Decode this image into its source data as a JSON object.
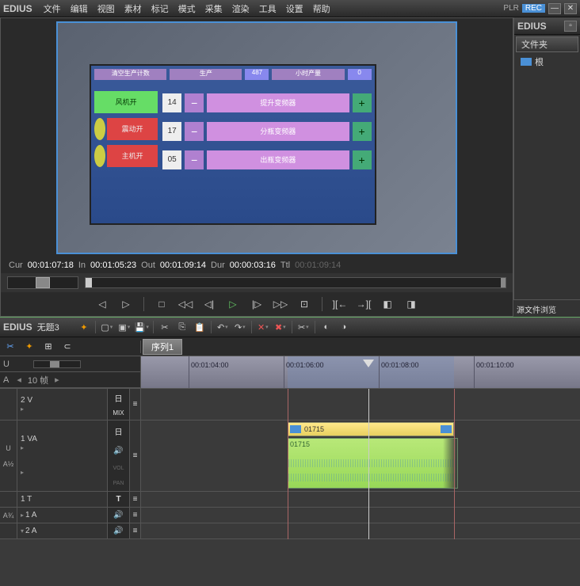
{
  "app": {
    "name": "EDIUS"
  },
  "menus": [
    "文件",
    "编辑",
    "视图",
    "素材",
    "标记",
    "模式",
    "采集",
    "渲染",
    "工具",
    "设置",
    "帮助"
  ],
  "recorder": {
    "plr": "PLR",
    "rec": "REC"
  },
  "sidePanel": {
    "tab": "文件夹",
    "item": "根",
    "bottom": "源文件浏览"
  },
  "monitor": {
    "topBoxes": [
      "清空生产计数",
      "生产",
      "487",
      "小时产量",
      "0"
    ],
    "leftButtons": [
      {
        "label": "风机开",
        "style": "green"
      },
      {
        "label": "震动开",
        "style": "red"
      },
      {
        "label": "主机开",
        "style": "red"
      }
    ],
    "rows": [
      {
        "num": "14",
        "bar": "提升变频器"
      },
      {
        "num": "17",
        "bar": "分瓶变频器"
      },
      {
        "num": "05",
        "bar": "出瓶变频器"
      }
    ]
  },
  "timecode": {
    "cur_lbl": "Cur",
    "cur": "00:01:07:18",
    "in_lbl": "In",
    "in": "00:01:05:23",
    "out_lbl": "Out",
    "out": "00:01:09:14",
    "dur_lbl": "Dur",
    "dur": "00:00:03:16",
    "ttl_lbl": "Ttl",
    "ttl": "00:01:09:14"
  },
  "timeline": {
    "title": "无题3",
    "sequence": "序列1",
    "frameUnit": "10 帧",
    "ruler": [
      "00:01:04:00",
      "00:01:06:00",
      "00:01:08:00",
      "00:01:10:00"
    ],
    "tracks": {
      "v2": "2 V",
      "va1": "1 VA",
      "t1": "1 T",
      "a1": "1 A",
      "a2": "2 A"
    },
    "clip": {
      "name": "01715",
      "aname": "01715"
    },
    "labels": {
      "u": "U",
      "a": "A",
      "a12": "A½",
      "a34": "A¾",
      "mix": "MIX",
      "day": "日",
      "vol": "VOL",
      "pan": "PAN",
      "t": "T"
    }
  }
}
